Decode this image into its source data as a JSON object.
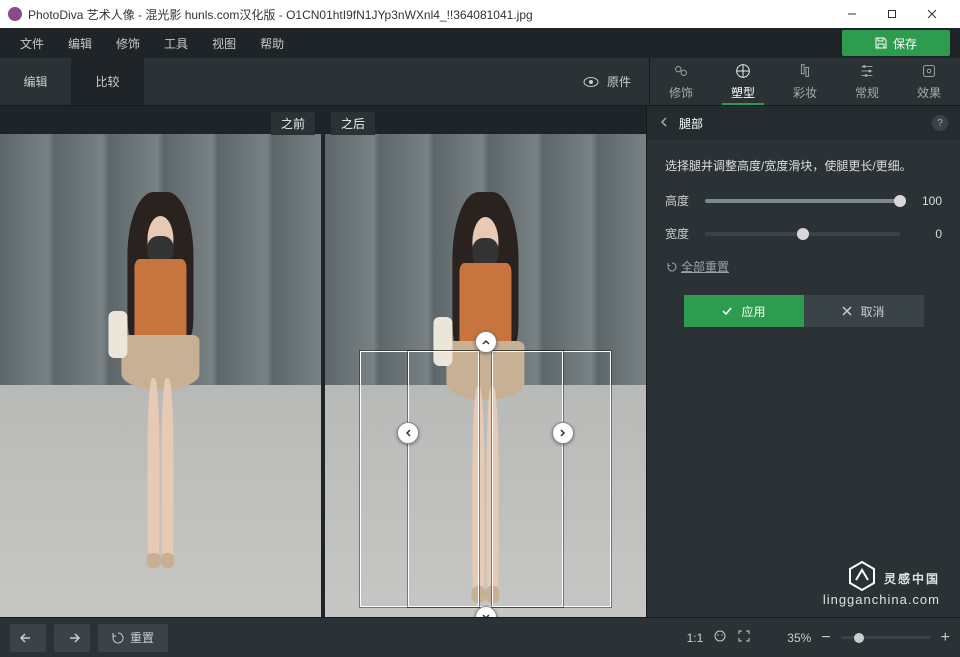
{
  "titlebar": {
    "app_name": "PhotoDiva 艺术人像 - 混光影 hunls.com汉化版",
    "filename": "O1CN01htI9fN1JYp3nWXnl4_!!364081041.jpg"
  },
  "menubar": {
    "items": [
      "文件",
      "编辑",
      "修饰",
      "工具",
      "视图",
      "帮助"
    ],
    "save": "保存"
  },
  "mode_tabs": {
    "edit": "编辑",
    "compare": "比较"
  },
  "original_btn": "原件",
  "right_tabs": {
    "retouch": "修饰",
    "sculpt": "塑型",
    "makeup": "彩妆",
    "general": "常规",
    "effects": "效果"
  },
  "canvas": {
    "before": "之前",
    "after": "之后"
  },
  "panel": {
    "title": "腿部",
    "description": "选择腿并调整高度/宽度滑块，使腿更长/更细。",
    "height_label": "高度",
    "height_value": "100",
    "width_label": "宽度",
    "width_value": "0",
    "reset_all": "全部重置",
    "apply": "应用",
    "cancel": "取消"
  },
  "bottombar": {
    "reset": "重置",
    "ratio": "1:1",
    "zoom": "35%"
  },
  "watermark": {
    "line1": "灵感中国",
    "line2": "lingganchina.com"
  }
}
